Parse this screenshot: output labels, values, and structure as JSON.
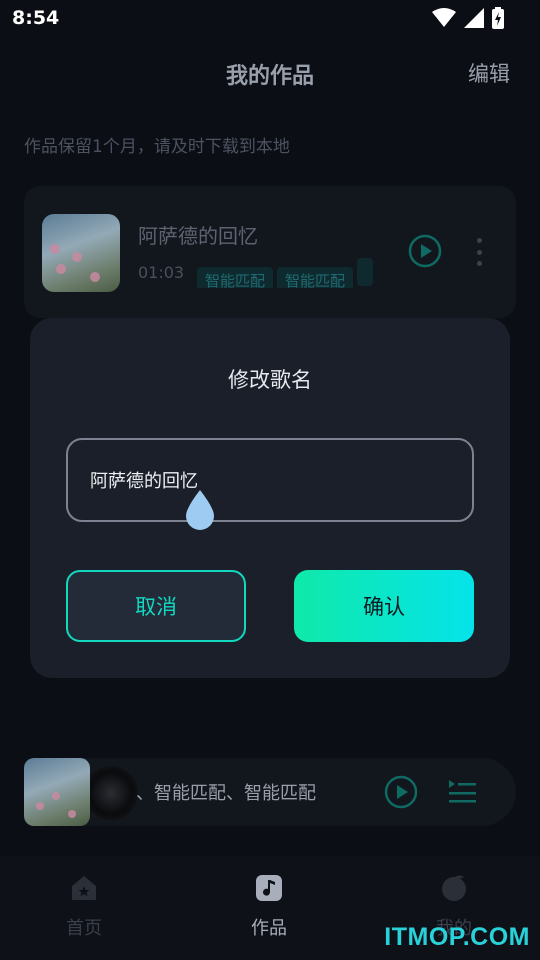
{
  "status_bar": {
    "time": "8:54"
  },
  "header": {
    "title": "我的作品",
    "edit_label": "编辑"
  },
  "notice": "作品保留1个月，请及时下载到本地",
  "work_item": {
    "title": "阿萨德的回忆",
    "duration": "01:03",
    "tags": [
      "智能匹配",
      "智能匹配"
    ]
  },
  "dialog": {
    "title": "修改歌名",
    "input_value": "阿萨德的回忆",
    "cancel_label": "取消",
    "confirm_label": "确认"
  },
  "mini_player": {
    "title": "、智能匹配、智能匹配"
  },
  "bottom_nav": {
    "items": [
      {
        "label": "首页",
        "icon": "home-icon"
      },
      {
        "label": "作品",
        "icon": "music-note-icon",
        "active": true
      },
      {
        "label": "我的",
        "icon": "profile-icon"
      }
    ]
  },
  "watermark": "ITMOP.COM",
  "colors": {
    "accent": "#12d8bf",
    "confirm_gradient_start": "#0fe9a9",
    "confirm_gradient_end": "#05e3ea",
    "dialog_bg": "#1a1f29",
    "page_bg": "#0b0e14"
  }
}
